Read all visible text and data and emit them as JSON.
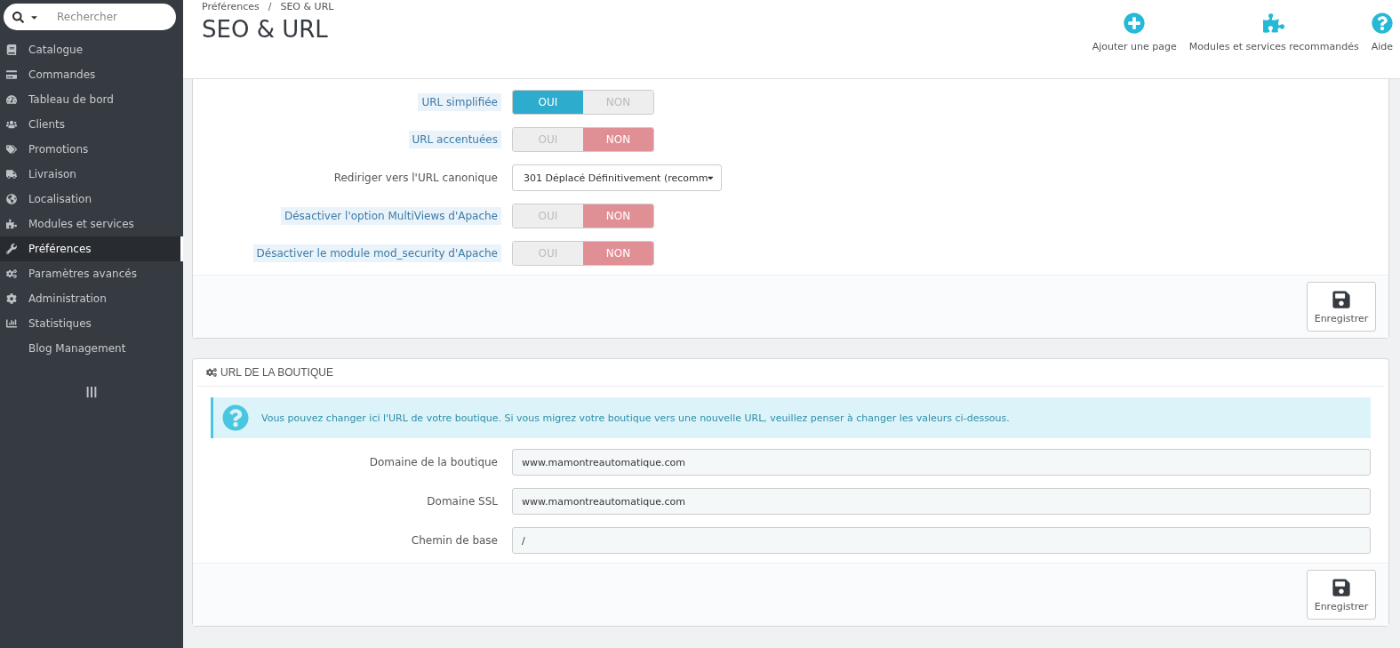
{
  "search": {
    "placeholder": "Rechercher"
  },
  "sidebar": {
    "items": [
      {
        "label": "Catalogue",
        "selected": false
      },
      {
        "label": "Commandes",
        "selected": false
      },
      {
        "label": "Tableau de bord",
        "selected": false
      },
      {
        "label": "Clients",
        "selected": false
      },
      {
        "label": "Promotions",
        "selected": false
      },
      {
        "label": "Livraison",
        "selected": false
      },
      {
        "label": "Localisation",
        "selected": false
      },
      {
        "label": "Modules et services",
        "selected": false
      },
      {
        "label": "Préférences",
        "selected": true
      },
      {
        "label": "Paramètres avancés",
        "selected": false
      },
      {
        "label": "Administration",
        "selected": false
      },
      {
        "label": "Statistiques",
        "selected": false
      },
      {
        "label": "Blog Management",
        "selected": false
      }
    ]
  },
  "header": {
    "breadcrumb": [
      "Préférences",
      "SEO & URL"
    ],
    "breadcrumb_separator": "/",
    "title": "SEO & URL",
    "actions": [
      "Ajouter une page",
      "Modules et services recommandés",
      "Aide"
    ]
  },
  "panels": [
    {
      "fields": [
        {
          "kind": "switch",
          "label": "URL simplifiée",
          "hint": true,
          "options": [
            "OUI",
            "NON"
          ],
          "on": true
        },
        {
          "kind": "switch",
          "label": "URL accentuées",
          "hint": true,
          "options": [
            "OUI",
            "NON"
          ],
          "on": false
        },
        {
          "kind": "select",
          "label": "Rediriger vers l'URL canonique",
          "hint": false,
          "value": "301 Déplacé Définitivement (recomm"
        },
        {
          "kind": "switch",
          "label": "Désactiver l'option MultiViews d'Apache",
          "hint": true,
          "options": [
            "OUI",
            "NON"
          ],
          "on": false
        },
        {
          "kind": "switch",
          "label": "Désactiver le module mod_security d'Apache",
          "hint": true,
          "options": [
            "OUI",
            "NON"
          ],
          "on": false
        }
      ],
      "save": "Enregistrer"
    },
    {
      "title": "URL DE LA BOUTIQUE",
      "alert": "Vous pouvez changer ici l'URL de votre boutique. Si vous migrez votre boutique vers une nouvelle URL, veuillez penser à changer les valeurs ci-dessous.",
      "fields": [
        {
          "kind": "text",
          "label": "Domaine de la boutique",
          "hint": false,
          "value": "www.mamontreautomatique.com"
        },
        {
          "kind": "text",
          "label": "Domaine SSL",
          "hint": false,
          "value": "www.mamontreautomatique.com"
        },
        {
          "kind": "text",
          "label": "Chemin de base",
          "hint": false,
          "value": "/"
        }
      ],
      "save": "Enregistrer"
    }
  ]
}
